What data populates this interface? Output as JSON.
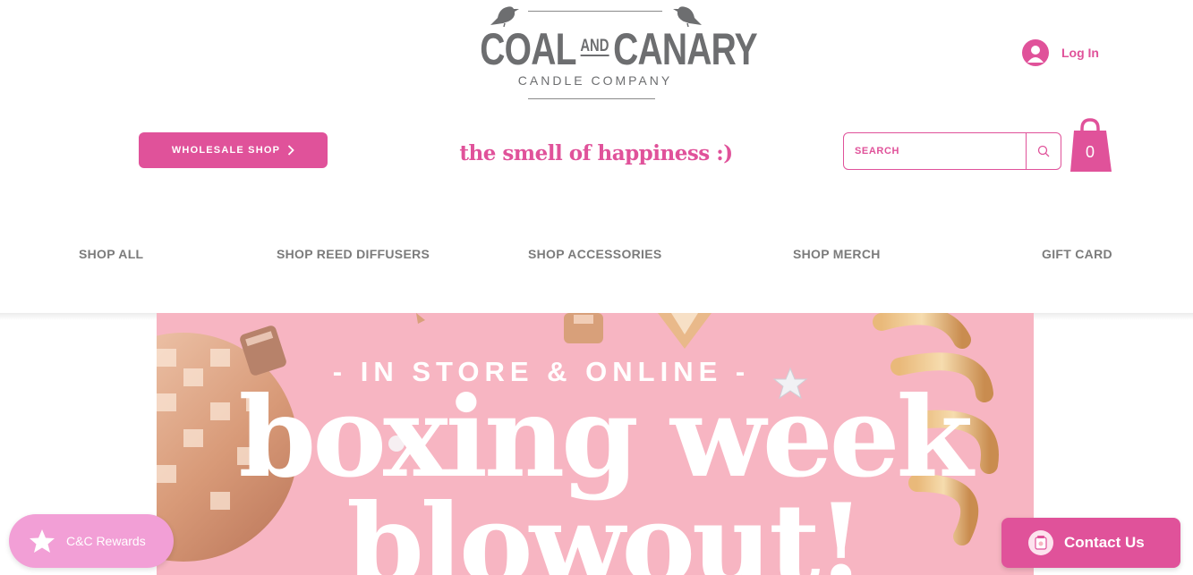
{
  "brand": {
    "main_left": "COAL",
    "and": "AND",
    "main_right": "CANARY",
    "sub": "CANDLE COMPANY"
  },
  "login": {
    "label": "Log In"
  },
  "wholesale": {
    "label": "WHOLESALE SHOP"
  },
  "tagline": "the smell of happiness :)",
  "search": {
    "placeholder": "SEARCH"
  },
  "cart": {
    "count": "0"
  },
  "nav": {
    "items": [
      "SHOP ALL",
      "SHOP REED DIFFUSERS",
      "SHOP ACCESSORIES",
      "SHOP MERCH",
      "GIFT CARD"
    ]
  },
  "hero": {
    "kicker": "- IN STORE & ONLINE -",
    "title_line1": "boxing week",
    "title_line2": "blowout!"
  },
  "rewards": {
    "label": "C&C Rewards"
  },
  "contact": {
    "label": "Contact Us"
  },
  "colors": {
    "accent": "#e0529a",
    "logo_gray": "#6d6e70",
    "nav_gray": "#7b7b7b",
    "hero_bg": "#f7b5c2",
    "rewards_bg": "#f29fd6"
  }
}
